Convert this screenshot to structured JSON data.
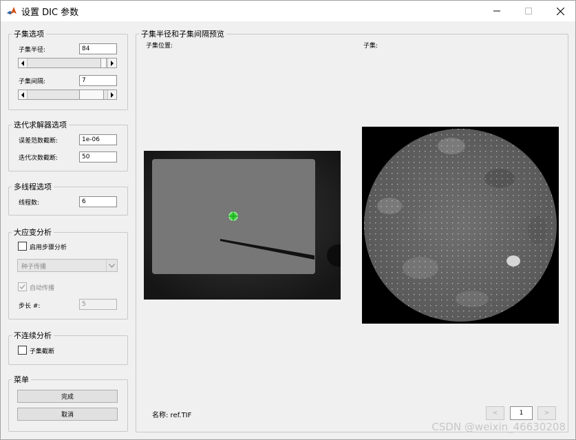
{
  "window": {
    "title": "设置 DIC 参数"
  },
  "subset_options": {
    "legend": "子集选项",
    "radius_label": "子集半径:",
    "radius_value": "84",
    "spacing_label": "子集间隔:",
    "spacing_value": "7"
  },
  "iterative_solver": {
    "legend": "迭代求解器选项",
    "diffnorm_label": "误差范数截断:",
    "diffnorm_value": "1e-06",
    "iter_label": "迭代次数截断:",
    "iter_value": "50"
  },
  "multithread": {
    "legend": "多线程选项",
    "threads_label": "线程数:",
    "threads_value": "6"
  },
  "large_strain": {
    "legend": "大应变分析",
    "enable_label": "启用步骤分析",
    "select_value": "种子传播",
    "auto_label": "自动传播",
    "step_label": "步长 #:",
    "step_value": "5"
  },
  "discontinuity": {
    "legend": "不连续分析",
    "truncation_label": "子集截断"
  },
  "menu": {
    "legend": "菜单",
    "finish_label": "完成",
    "cancel_label": "取消"
  },
  "preview": {
    "legend": "子集半径和子集间隔预览",
    "location_label": "子集位置:",
    "subset_label": "子集:",
    "name_label": "名称: ref.TIF",
    "prev_label": "<",
    "page_value": "1",
    "next_label": ">"
  },
  "watermark": "CSDN @weixin_46630208"
}
